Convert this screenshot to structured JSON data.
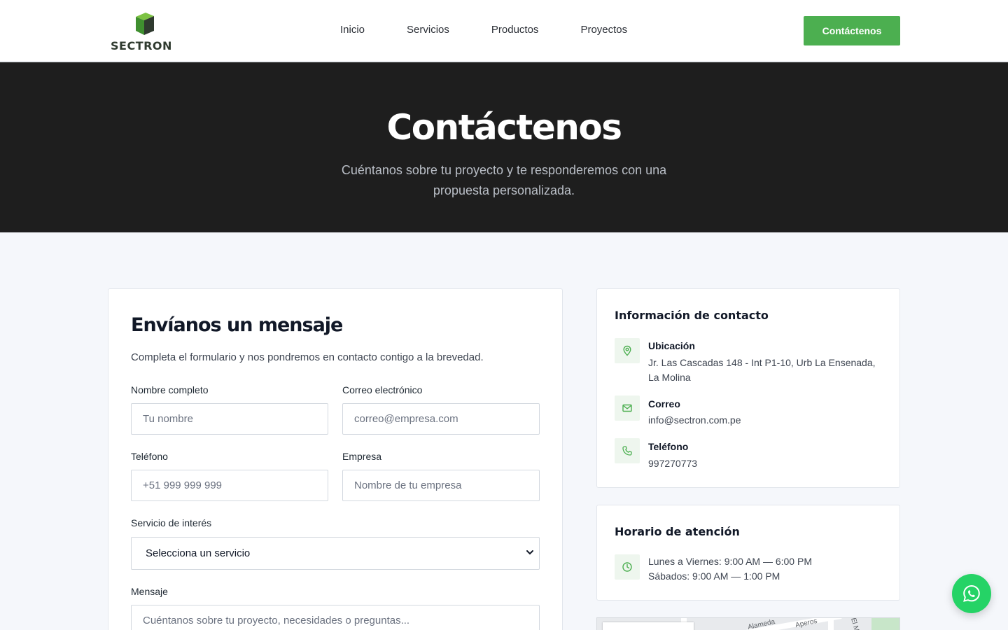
{
  "brand": {
    "name": "SECTRON",
    "accent_color": "#4caf50"
  },
  "nav": {
    "items": [
      "Inicio",
      "Servicios",
      "Productos",
      "Proyectos"
    ],
    "cta_label": "Contáctenos"
  },
  "hero": {
    "title": "Contáctenos",
    "subtitle": "Cuéntanos sobre tu proyecto y te responderemos con una propuesta personalizada."
  },
  "form": {
    "title": "Envíanos un mensaje",
    "description": "Completa el formulario y nos pondremos en contacto contigo a la brevedad.",
    "fields": {
      "name": {
        "label": "Nombre completo",
        "placeholder": "Tu nombre"
      },
      "email": {
        "label": "Correo electrónico",
        "placeholder": "correo@empresa.com"
      },
      "phone": {
        "label": "Teléfono",
        "placeholder": "+51 999 999 999"
      },
      "company": {
        "label": "Empresa",
        "placeholder": "Nombre de tu empresa"
      },
      "service": {
        "label": "Servicio de interés",
        "value": "Selecciona un servicio"
      },
      "message": {
        "label": "Mensaje",
        "placeholder": "Cuéntanos sobre tu proyecto, necesidades o preguntas..."
      }
    }
  },
  "contact_info": {
    "title": "Información de contacto",
    "location": {
      "title": "Ubicación",
      "text": "Jr. Las Cascadas 148 - Int P1-10, Urb La Ensenada, La Molina"
    },
    "email": {
      "title": "Correo",
      "text": "info@sectron.com.pe"
    },
    "phone": {
      "title": "Teléfono",
      "text": "997270773"
    }
  },
  "hours": {
    "title": "Horario de atención",
    "weekdays": "Lunes a Viernes: 9:00 AM — 6:00 PM",
    "saturday": "Sábados: 9:00 AM — 1:00 PM"
  },
  "map": {
    "labels": [
      "Alameda",
      "Aperos",
      "El M"
    ]
  },
  "icons": {
    "location": "map-pin-icon",
    "email": "mail-icon",
    "phone": "phone-icon",
    "hours": "clock-icon",
    "whatsapp": "whatsapp-icon"
  }
}
